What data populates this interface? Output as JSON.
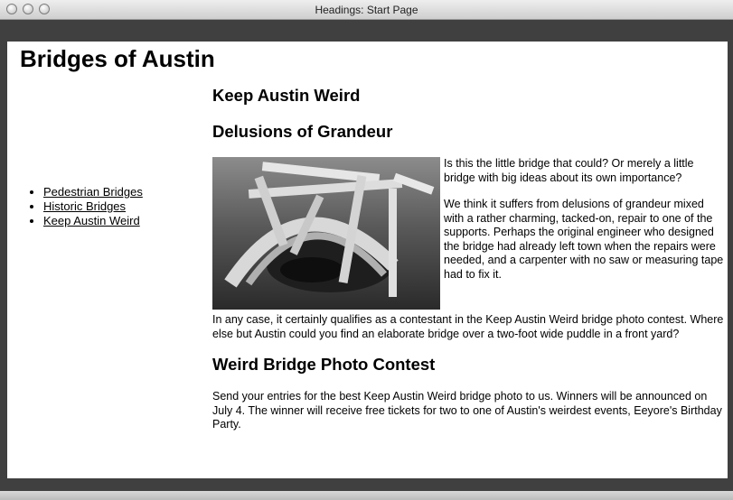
{
  "window": {
    "title": "Headings: Start Page"
  },
  "page": {
    "heading": "Bridges of Austin",
    "nav": [
      "Pedestrian Bridges",
      "Historic Bridges",
      "Keep Austin Weird"
    ],
    "section_title": "Keep Austin Weird",
    "subsection_title": "Delusions of Grandeur",
    "p1": "Is this the little bridge that could? Or merely a little bridge with big ideas about its own importance?",
    "p2": "We think it suffers from delusions of grandeur mixed with a rather charming, tacked-on, repair to one of the supports. Perhaps the original engineer who designed the bridge had already left town when the repairs were needed, and a carpenter with no saw or measuring tape had to fix it.",
    "p3": "In any case, it certainly qualifies as a contestant in the Keep Austin Weird bridge photo contest. Where else but Austin could you find an elaborate bridge over a two-foot wide puddle in a front yard?",
    "contest_title": "Weird Bridge Photo Contest",
    "p4": "Send your entries for the best Keep Austin Weird bridge photo to us. Winners will be announced on July 4. The winner will receive free tickets for two to one of Austin's weirdest events, Eeyore's Birthday Party."
  }
}
